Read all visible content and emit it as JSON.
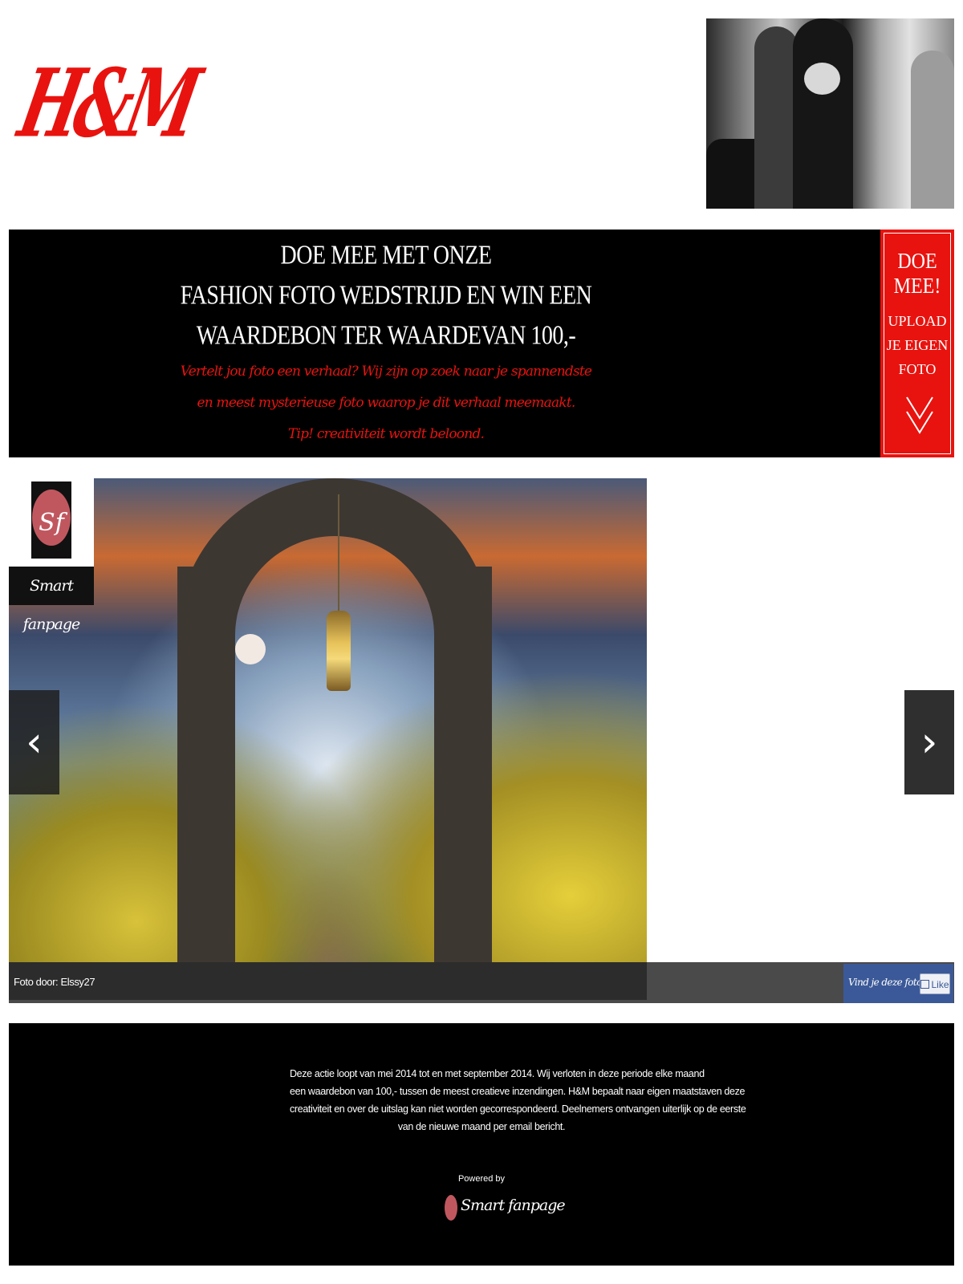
{
  "brand": {
    "logo_text": "H&M",
    "accent_color": "#e8130f"
  },
  "banner": {
    "heading_lines": [
      "DOE MEE MET ONZE",
      "FASHION FOTO WEDSTRIJD EN WIN EEN",
      "WAARDEBON TER WAARDEVAN 100,-"
    ],
    "tagline_lines": [
      "Vertelt jou foto een verhaal? Wij zijn op zoek naar je spannendste",
      "en meest mysterieuse foto waarop je dit verhaal meemaakt.",
      "Tip! creativiteit wordt beloond."
    ]
  },
  "cta": {
    "title": "DOE MEE!",
    "subtitle": "UPLOAD\nJE EIGEN\nFOTO",
    "icon": "double-chevron-down-icon"
  },
  "gallery": {
    "badge_letter": "Sf",
    "badge_label": "Smart fanpage",
    "prev_arrow": "‹",
    "next_arrow": "›",
    "caption": "Foto door: Elssy27",
    "like_question": "Vind je deze foto leuk?",
    "like_label": "Like"
  },
  "footer": {
    "text_lines": [
      "Deze actie loopt van mei 2014 tot en met september 2014. Wij verloten in deze periode elke maand",
      "een waardebon van 100,- tussen de meest creatieve inzendingen. H&M bepaalt naar eigen maatstaven deze",
      "creativiteit en over de uitslag kan niet worden gecorrespondeerd. Deelnemers ontvangen uiterlijk op de eerste",
      "van de nieuwe maand per email bericht."
    ],
    "powered_by": "Powered by",
    "powered_brand": "Smart fanpage"
  }
}
